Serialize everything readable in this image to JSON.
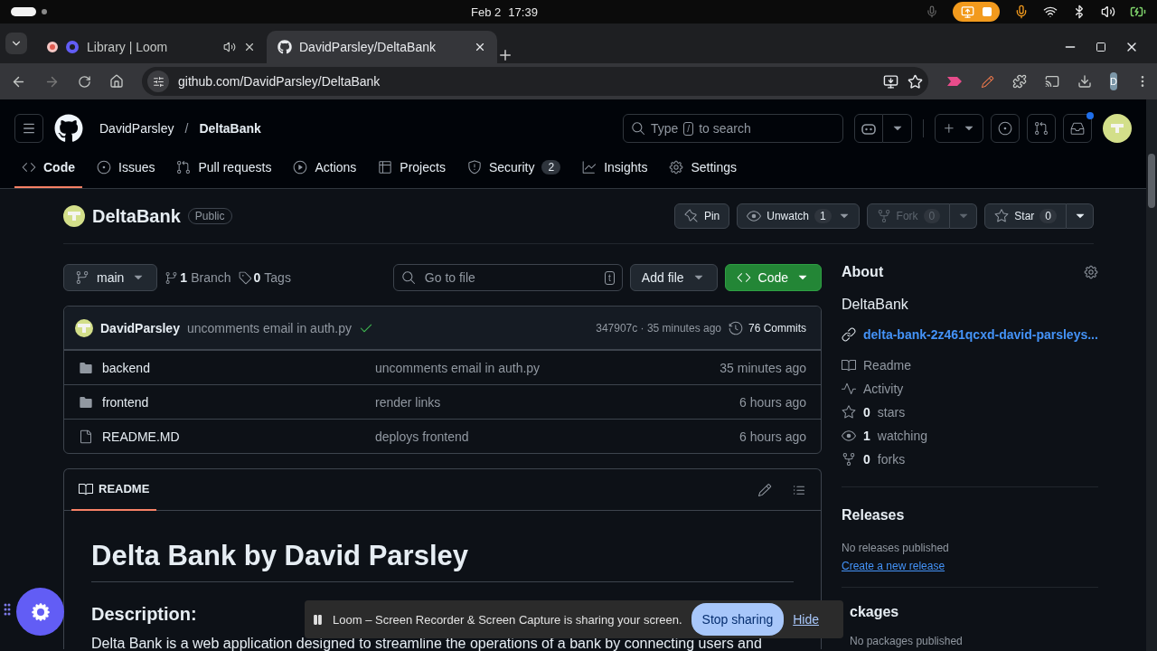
{
  "system_bar": {
    "date": "Feb 2",
    "time": "17:39"
  },
  "browser": {
    "tabs": [
      {
        "title": "Library | Loom",
        "selected": false,
        "recording": true,
        "audio": true
      },
      {
        "title": "DavidParsley/DeltaBank",
        "selected": true,
        "recording": false,
        "audio": false
      }
    ],
    "address": "github.com/DavidParsley/DeltaBank",
    "profile_initial": "D"
  },
  "header": {
    "owner": "DavidParsley",
    "separator": "/",
    "repo": "DeltaBank",
    "search": {
      "before": "Type",
      "key": "/",
      "after": "to search"
    },
    "inbox_unread": true
  },
  "nav": [
    {
      "label": "Code",
      "selected": true
    },
    {
      "label": "Issues",
      "selected": false
    },
    {
      "label": "Pull requests",
      "selected": false
    },
    {
      "label": "Actions",
      "selected": false
    },
    {
      "label": "Projects",
      "selected": false
    },
    {
      "label": "Security",
      "selected": false,
      "count": "2"
    },
    {
      "label": "Insights",
      "selected": false
    },
    {
      "label": "Settings",
      "selected": false
    }
  ],
  "repo": {
    "name": "DeltaBank",
    "visibility": "Public",
    "actions": [
      {
        "label": "Pin",
        "disabled": false,
        "menu": false
      },
      {
        "label": "Unwatch",
        "count": "1",
        "disabled": false,
        "menu": true
      },
      {
        "label": "Fork",
        "count": "0",
        "disabled": true,
        "menu": true
      },
      {
        "label": "Star",
        "count": "0",
        "disabled": false,
        "menu": true
      }
    ]
  },
  "toolbar": {
    "branch": "main",
    "branches": "**1** Branch",
    "tags": "**0** Tags",
    "go_to_file": {
      "placeholder": "Go to file",
      "key": "t"
    },
    "add_file": "Add file",
    "code": "Code"
  },
  "commit": {
    "author": "DavidParsley",
    "message": "uncomments email in auth.py",
    "passed": true,
    "hash_time": "347907c · 35 minutes ago",
    "commits": "76 Commits"
  },
  "files": [
    {
      "name": "backend",
      "kind": "folder",
      "message": "uncomments email in auth.py",
      "time": "35 minutes ago"
    },
    {
      "name": "frontend",
      "kind": "folder",
      "message": "render links",
      "time": "6 hours ago"
    },
    {
      "name": "README.MD",
      "kind": "file",
      "message": "deploys frontend",
      "time": "6 hours ago"
    }
  ],
  "readme": {
    "tab": "README",
    "title": "Delta Bank by David Parsley",
    "heading": "Description:",
    "paragraph": "Delta Bank is a web application designed to streamline the operations of a bank by connecting users and"
  },
  "about": {
    "title": "About",
    "description": "DeltaBank",
    "link": "delta-bank-2z461qcxd-david-parsleys...",
    "items": [
      "Readme",
      "Activity",
      "**0** stars",
      "**1** watching",
      "**0** forks"
    ]
  },
  "releases": {
    "title": "Releases",
    "note": "No releases published",
    "link": "Create a new release"
  },
  "packages": {
    "title": "ckages",
    "note": "No packages published"
  },
  "share_bar": {
    "message": "Loom – Screen Recorder & Screen Capture is sharing your screen.",
    "stop": "Stop sharing",
    "hide": "Hide"
  }
}
